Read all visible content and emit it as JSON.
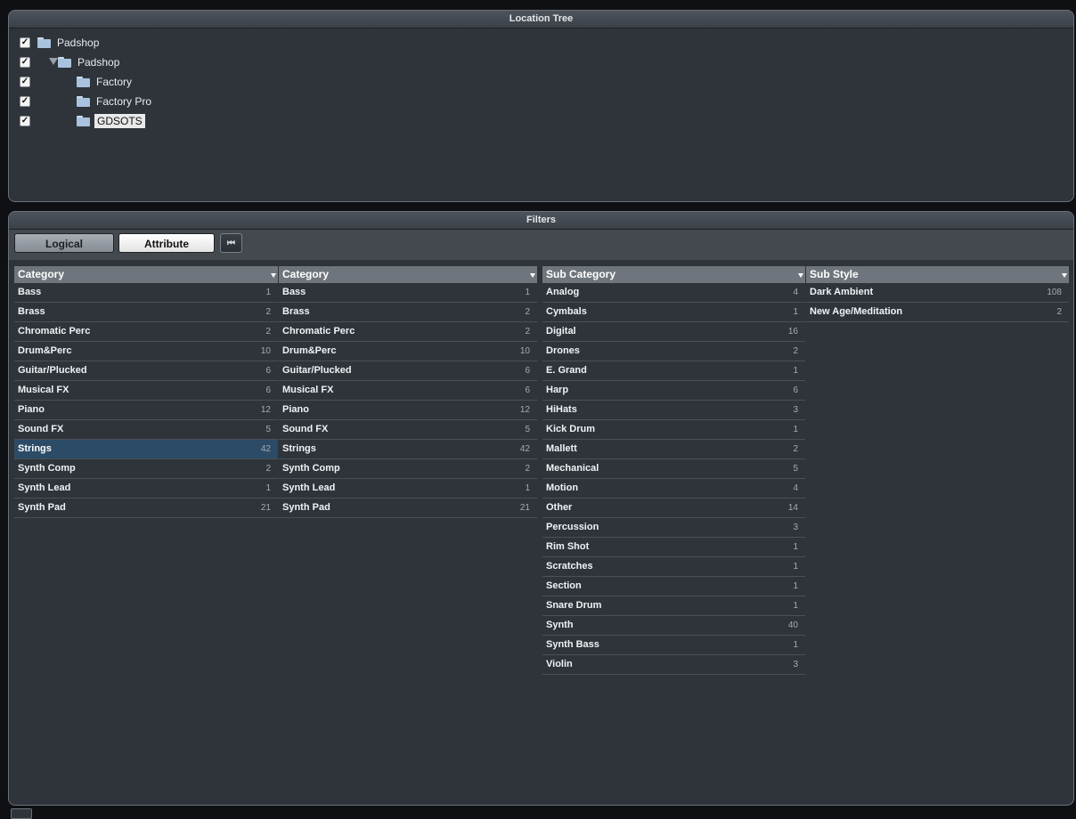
{
  "location_tree": {
    "title": "Location Tree",
    "items": [
      {
        "label": "Padshop",
        "checked": true,
        "level": 0,
        "expanded": false,
        "selected": false
      },
      {
        "label": "Padshop",
        "checked": true,
        "level": 0,
        "expanded": true,
        "selected": false
      },
      {
        "label": "Factory",
        "checked": true,
        "level": 1,
        "selected": false
      },
      {
        "label": "Factory Pro",
        "checked": true,
        "level": 1,
        "selected": false
      },
      {
        "label": "GDSOTS",
        "checked": true,
        "level": 1,
        "selected": true
      }
    ]
  },
  "filters": {
    "title": "Filters",
    "buttons": {
      "logical": "Logical",
      "attribute": "Attribute",
      "reset": "⏮"
    },
    "columns": [
      {
        "header": "Category",
        "rows": [
          {
            "name": "Bass",
            "count": "1"
          },
          {
            "name": "Brass",
            "count": "2"
          },
          {
            "name": "Chromatic Perc",
            "count": "2"
          },
          {
            "name": "Drum&Perc",
            "count": "10"
          },
          {
            "name": "Guitar/Plucked",
            "count": "6"
          },
          {
            "name": "Musical FX",
            "count": "6"
          },
          {
            "name": "Piano",
            "count": "12"
          },
          {
            "name": "Sound FX",
            "count": "5"
          },
          {
            "name": "Strings",
            "count": "42",
            "selected": true
          },
          {
            "name": "Synth Comp",
            "count": "2"
          },
          {
            "name": "Synth Lead",
            "count": "1"
          },
          {
            "name": "Synth Pad",
            "count": "21"
          }
        ]
      },
      {
        "header": "Category",
        "rows": [
          {
            "name": "Bass",
            "count": "1"
          },
          {
            "name": "Brass",
            "count": "2"
          },
          {
            "name": "Chromatic Perc",
            "count": "2"
          },
          {
            "name": "Drum&Perc",
            "count": "10"
          },
          {
            "name": "Guitar/Plucked",
            "count": "6"
          },
          {
            "name": "Musical FX",
            "count": "6"
          },
          {
            "name": "Piano",
            "count": "12"
          },
          {
            "name": "Sound FX",
            "count": "5"
          },
          {
            "name": "Strings",
            "count": "42"
          },
          {
            "name": "Synth Comp",
            "count": "2"
          },
          {
            "name": "Synth Lead",
            "count": "1"
          },
          {
            "name": "Synth Pad",
            "count": "21"
          }
        ]
      },
      {
        "header": "Sub Category",
        "rows": [
          {
            "name": "Analog",
            "count": "4"
          },
          {
            "name": "Cymbals",
            "count": "1"
          },
          {
            "name": "Digital",
            "count": "16"
          },
          {
            "name": "Drones",
            "count": "2"
          },
          {
            "name": "E. Grand",
            "count": "1"
          },
          {
            "name": "Harp",
            "count": "6"
          },
          {
            "name": "HiHats",
            "count": "3"
          },
          {
            "name": "Kick Drum",
            "count": "1"
          },
          {
            "name": "Mallett",
            "count": "2"
          },
          {
            "name": "Mechanical",
            "count": "5"
          },
          {
            "name": "Motion",
            "count": "4"
          },
          {
            "name": "Other",
            "count": "14"
          },
          {
            "name": "Percussion",
            "count": "3"
          },
          {
            "name": "Rim Shot",
            "count": "1"
          },
          {
            "name": "Scratches",
            "count": "1"
          },
          {
            "name": "Section",
            "count": "1"
          },
          {
            "name": "Snare Drum",
            "count": "1"
          },
          {
            "name": "Synth",
            "count": "40"
          },
          {
            "name": "Synth Bass",
            "count": "1"
          },
          {
            "name": "Violin",
            "count": "3"
          }
        ]
      },
      {
        "header": "Sub Style",
        "rows": [
          {
            "name": "Dark Ambient",
            "count": "108"
          },
          {
            "name": "New Age/Meditation",
            "count": "2"
          }
        ]
      }
    ]
  },
  "colors": {
    "panel_bg": "#2f343b",
    "column_header_bg": "#6f757c",
    "selection_bg": "#2c4b66",
    "folder": "#a9c3de"
  }
}
